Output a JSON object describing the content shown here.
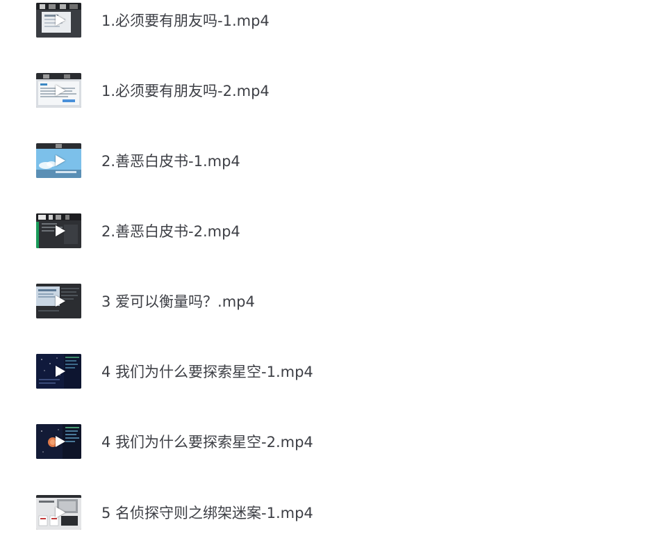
{
  "files": [
    {
      "name": "1.必须要有朋友吗-1.mp4",
      "thumb": "slides-light",
      "icon": "play-icon"
    },
    {
      "name": "1.必须要有朋友吗-2.mp4",
      "thumb": "document-light",
      "icon": "play-icon"
    },
    {
      "name": "2.善恶白皮书-1.mp4",
      "thumb": "sky-blue",
      "icon": "play-icon"
    },
    {
      "name": "2.善恶白皮书-2.mp4",
      "thumb": "dark-grid",
      "icon": "play-icon"
    },
    {
      "name": "3 爱可以衡量吗？.mp4",
      "thumb": "dark-slide",
      "icon": "play-icon"
    },
    {
      "name": "4 我们为什么要探索星空-1.mp4",
      "thumb": "dark-code",
      "icon": "play-icon"
    },
    {
      "name": "4 我们为什么要探索星空-2.mp4",
      "thumb": "dark-planet",
      "icon": "play-icon"
    },
    {
      "name": "5 名侦探守则之绑架迷案-1.mp4",
      "thumb": "light-photo",
      "icon": "play-icon"
    }
  ]
}
